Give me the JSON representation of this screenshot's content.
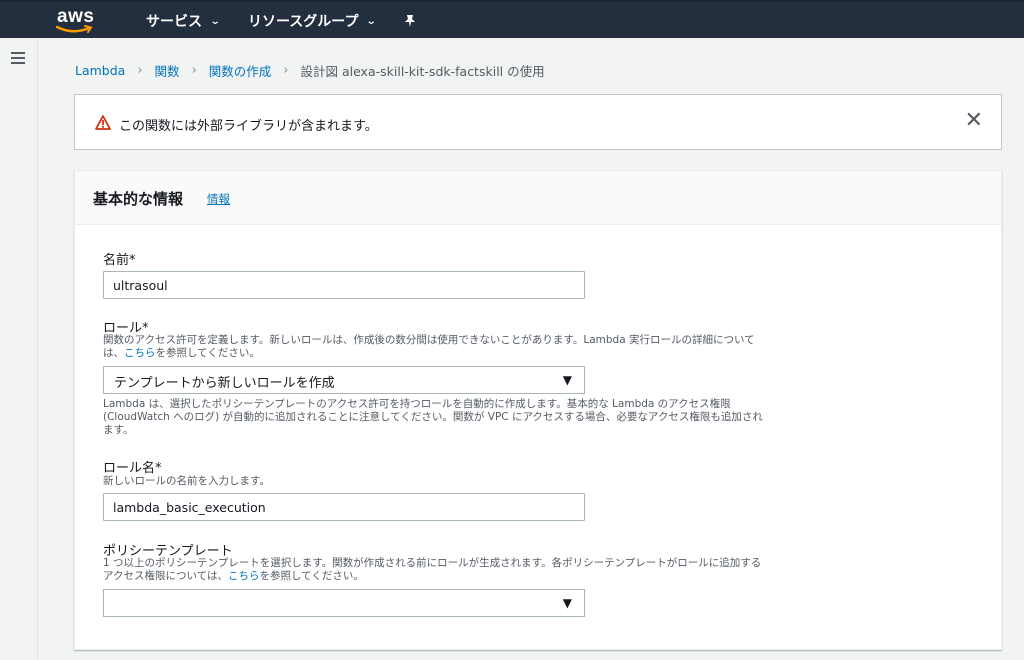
{
  "nav": {
    "logo": "aws",
    "services": "サービス",
    "resource_groups": "リソースグループ",
    "caret": "⌄"
  },
  "breadcrumb": {
    "items": [
      "Lambda",
      "関数",
      "関数の作成"
    ],
    "current": "設計図 alexa-skill-kit-sdk-factskill の使用"
  },
  "alert": {
    "message": "この関数には外部ライブラリが含まれます。",
    "close": "✕"
  },
  "panel": {
    "title": "基本的な情報",
    "info_link": "情報",
    "name": {
      "label": "名前*",
      "value": "ultrasoul"
    },
    "role": {
      "label": "ロール*",
      "desc_before": "関数のアクセス許可を定義します。新しいロールは、作成後の数分間は使用できないことがあります。Lambda 実行ロールの詳細については、",
      "desc_link": "こちら",
      "desc_after": "を参照してください。",
      "selected": "テンプレートから新しいロールを作成",
      "note": "Lambda は、選択したポリシーテンプレートのアクセス許可を持つロールを自動的に作成します。基本的な Lambda のアクセス権限 (CloudWatch へのログ) が自動的に追加されることに注意してください。関数が VPC にアクセスする場合、必要なアクセス権限も追加されます。"
    },
    "role_name": {
      "label": "ロール名*",
      "desc": "新しいロールの名前を入力します。",
      "value": "lambda_basic_execution"
    },
    "policy": {
      "label": "ポリシーテンプレート",
      "desc_before": "1 つ以上のポリシーテンプレートを選択します。関数が作成される前にロールが生成されます。各ポリシーテンプレートがロールに追加するアクセス権限については、",
      "desc_link": "こちら",
      "desc_after": "を参照してください。",
      "selected": ""
    }
  },
  "colors": {
    "nav_bg": "#232f3e",
    "link": "#0073bb",
    "warning": "#d13212",
    "aws_orange": "#ff9900"
  }
}
